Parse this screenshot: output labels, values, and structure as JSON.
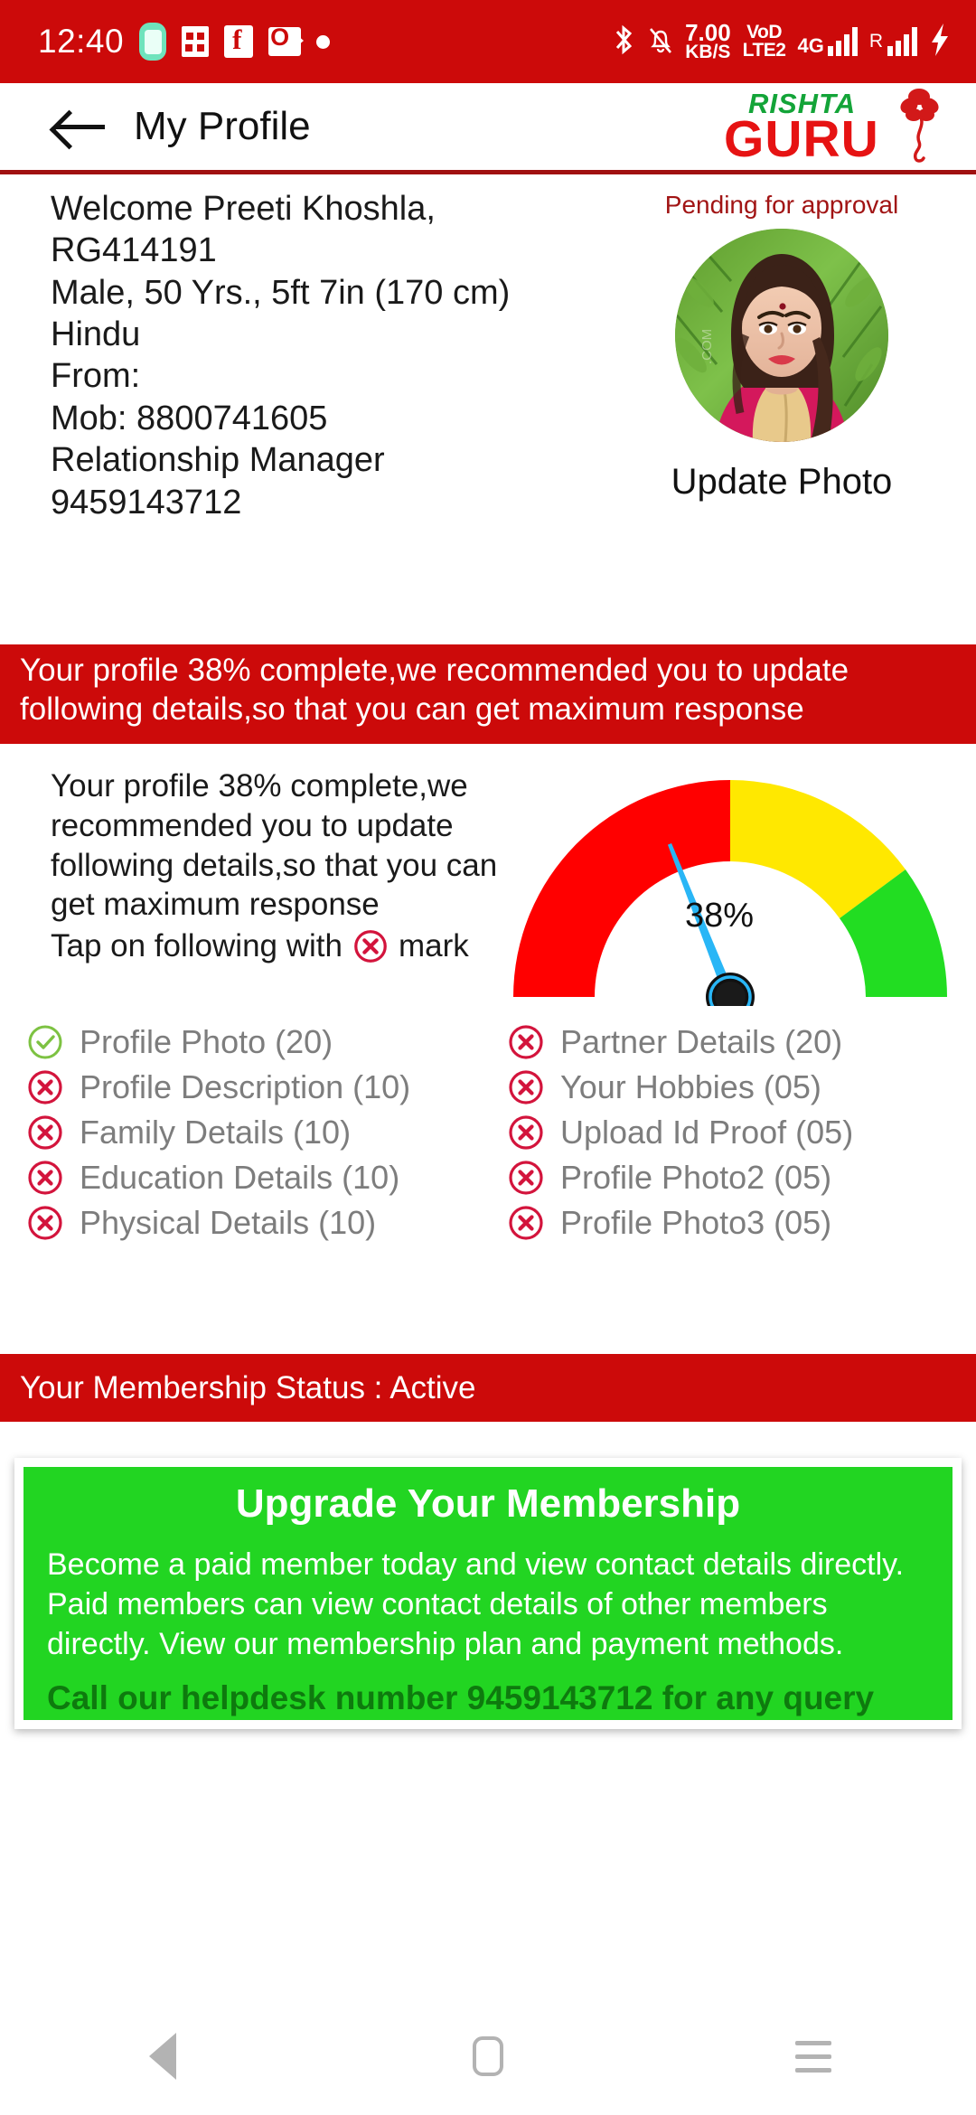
{
  "statusbar": {
    "time": "12:40",
    "data_rate_value": "7.00",
    "data_rate_unit": "KB/S",
    "volte_top": "VoD",
    "volte_bottom": "LTE2",
    "network": "4G",
    "roaming": "R",
    "icons": [
      "battery-saver-icon",
      "calculator-icon",
      "facebook-icon",
      "outlook-icon",
      "dot-icon",
      "bluetooth-icon",
      "silent-bell-icon",
      "signal-bars-icon",
      "charging-bolt-icon"
    ]
  },
  "header": {
    "title": "My Profile",
    "logo_top": "RISHTA",
    "logo_bottom": "GURU"
  },
  "profile": {
    "lines": [
      "Welcome Preeti Khoshla,",
      "RG414191",
      "Male, 50 Yrs., 5ft 7in (170 cm)",
      "Hindu",
      "From:",
      "Mob: 8800741605",
      "Relationship Manager",
      "9459143712"
    ],
    "photo_status": "Pending for approval",
    "update_photo_label": "Update Photo"
  },
  "banner": {
    "text": "Your profile 38% complete,we recommended you to update following details,so that you can get maximum response"
  },
  "gauge_section": {
    "description": "Your profile 38% complete,we recommended you to update following details,so that you can get maximum response",
    "tap_prefix": "Tap on following with",
    "tap_suffix": "mark"
  },
  "chart_data": {
    "type": "gauge",
    "title": "Profile completion gauge",
    "value": 38,
    "value_label": "38%",
    "min": 0,
    "max": 100,
    "start_angle": 180,
    "end_angle": 0,
    "needle_color": "#29B6F6",
    "hub_color": "#111111",
    "bands": [
      {
        "name": "low",
        "from": 0,
        "to": 50,
        "color": "#FF0000"
      },
      {
        "name": "medium",
        "from": 50,
        "to": 80,
        "color": "#FFE800"
      },
      {
        "name": "high",
        "from": 80,
        "to": 100,
        "color": "#22DD22"
      }
    ]
  },
  "checklist": {
    "left": [
      {
        "label": "Profile Photo (20)",
        "status": "complete"
      },
      {
        "label": "Profile Description (10)",
        "status": "incomplete"
      },
      {
        "label": "Family Details (10)",
        "status": "incomplete"
      },
      {
        "label": "Education Details (10)",
        "status": "incomplete"
      },
      {
        "label": "Physical Details (10)",
        "status": "incomplete"
      }
    ],
    "right": [
      {
        "label": "Partner Details (20)",
        "status": "incomplete"
      },
      {
        "label": "Your Hobbies (05)",
        "status": "incomplete"
      },
      {
        "label": "Upload Id Proof (05)",
        "status": "incomplete"
      },
      {
        "label": "Profile Photo2 (05)",
        "status": "incomplete"
      },
      {
        "label": "Profile Photo3 (05)",
        "status": "incomplete"
      }
    ]
  },
  "membership": {
    "status_text": "Your Membership Status : Active",
    "card_title": "Upgrade Your Membership",
    "card_body": "Become a paid member today and view contact details directly. Paid members can view contact details of other members directly. View our membership plan and payment methods.",
    "card_helpdesk": "Call our helpdesk number 9459143712 for any query"
  },
  "navbar": {
    "back": "back-triangle-icon",
    "home": "home-pill-icon",
    "recents": "recents-lines-icon"
  },
  "colors": {
    "brand_red": "#CC0A0A",
    "brand_green": "#22D522",
    "dark_green": "#0E7A0E",
    "logo_green": "#13A438",
    "logo_red": "#E61313",
    "pending_red": "#A11414",
    "check_green": "#7DC242",
    "cross_red": "#D3143C"
  }
}
